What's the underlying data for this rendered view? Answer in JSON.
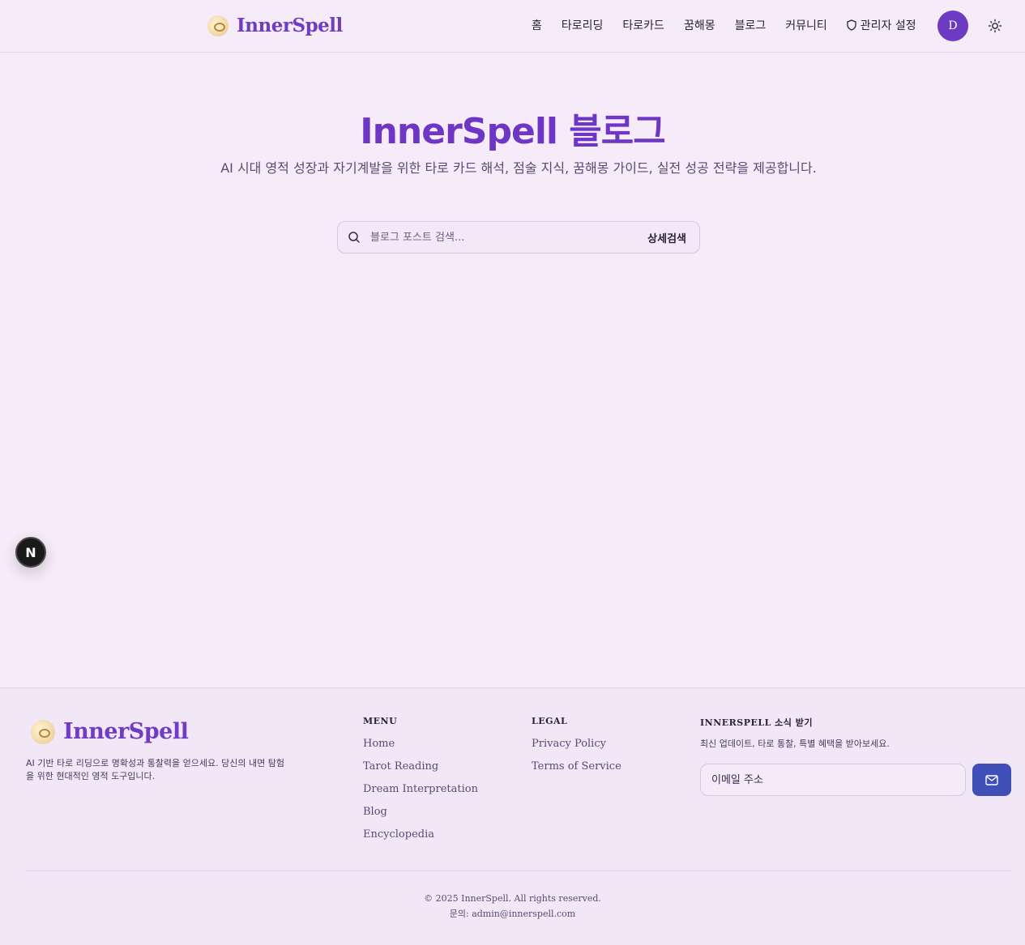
{
  "header": {
    "logo_text": "InnerSpell",
    "nav": [
      "홈",
      "타로리딩",
      "타로카드",
      "꿈해몽",
      "블로그",
      "커뮤니티"
    ],
    "admin_label": "관리자 설정",
    "avatar_initial": "D",
    "theme_icon": "sun-icon"
  },
  "hero": {
    "title": "InnerSpell 블로그",
    "description": "AI 시대 영적 성장과 자기계발을 위한 타로 카드 해석, 점술 지식, 꿈해몽 가이드, 실전 성공 전략을 제공합니다.",
    "search_placeholder": "블로그 포스트 검색...",
    "advanced_search": "상세검색"
  },
  "floating_badge": "N",
  "footer": {
    "logo_text": "InnerSpell",
    "description": "AI 기반 타로 리딩으로 명확성과 통찰력을 얻으세요. 당신의 내면 탐험을 위한 현대적인 영적 도구입니다.",
    "menu_title": "MENU",
    "menu_links": [
      "Home",
      "Tarot Reading",
      "Dream Interpretation",
      "Blog",
      "Encyclopedia"
    ],
    "legal_title": "LEGAL",
    "legal_links": [
      "Privacy Policy",
      "Terms of Service"
    ],
    "newsletter_title": "INNERSPELL 소식 받기",
    "newsletter_desc": "최신 업데이트, 타로 통찰, 특별 혜택을 받아보세요.",
    "email_placeholder": "이메일 주소",
    "copyright": "© 2025 InnerSpell. All rights reserved.",
    "contact": "문의: admin@innerspell.com"
  },
  "colors": {
    "brand": "#6e36c4",
    "background": "#f6ebf8",
    "send_button": "#3f4fb7"
  }
}
